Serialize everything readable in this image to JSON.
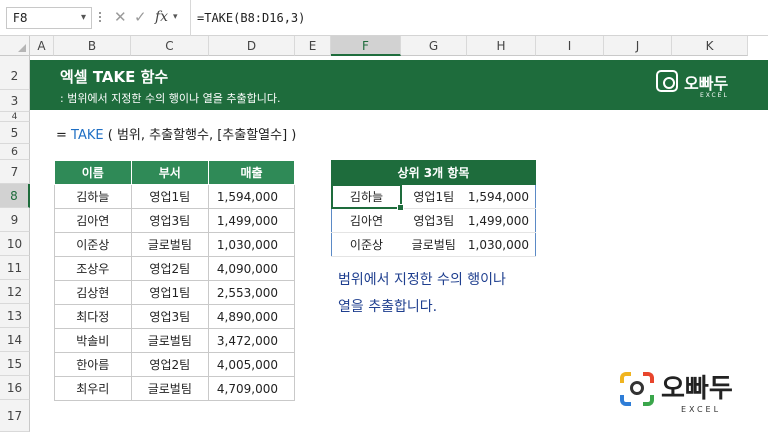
{
  "formula_bar": {
    "name_box": "F8",
    "formula": "=TAKE(B8:D16,3)",
    "fx_label": "fx"
  },
  "columns": [
    "A",
    "B",
    "C",
    "D",
    "E",
    "F",
    "G",
    "H",
    "I",
    "J",
    "K"
  ],
  "selected_column": "F",
  "rows": [
    "2",
    "3",
    "4",
    "5",
    "6",
    "7",
    "8",
    "9",
    "10",
    "11",
    "12",
    "13",
    "14",
    "15",
    "16",
    "17"
  ],
  "selected_row": "8",
  "banner": {
    "title": "엑셀 TAKE 함수",
    "subtitle": ": 범위에서 지정한 수의 행이나 열을 추출합니다.",
    "logo_name": "오빠두",
    "logo_sub": "EXCEL"
  },
  "syntax": {
    "eq": "=",
    "func": "TAKE",
    "args": " ( 범위, 추출할행수, [추출할열수] )"
  },
  "source_table": {
    "headers": [
      "이름",
      "부서",
      "매출"
    ],
    "rows": [
      [
        "김하늘",
        "영업1팀",
        "1,594,000"
      ],
      [
        "김아연",
        "영업3팀",
        "1,499,000"
      ],
      [
        "이준상",
        "글로벌팀",
        "1,030,000"
      ],
      [
        "조상우",
        "영업2팀",
        "4,090,000"
      ],
      [
        "김상현",
        "영업1팀",
        "2,553,000"
      ],
      [
        "최다정",
        "영업3팀",
        "4,890,000"
      ],
      [
        "박솔비",
        "글로벌팀",
        "3,472,000"
      ],
      [
        "한아름",
        "영업2팀",
        "4,005,000"
      ],
      [
        "최우리",
        "글로벌팀",
        "4,709,000"
      ]
    ]
  },
  "result_table": {
    "header": "상위 3개 항목",
    "rows": [
      [
        "김하늘",
        "영업1팀",
        "1,594,000"
      ],
      [
        "김아연",
        "영업3팀",
        "1,499,000"
      ],
      [
        "이준상",
        "글로벌팀",
        "1,030,000"
      ]
    ]
  },
  "note": {
    "line1": "범위에서 지정한 수의 행이나",
    "line2": "열을 추출합니다."
  },
  "watermark": {
    "name": "오빠두",
    "sub": "EXCEL"
  }
}
